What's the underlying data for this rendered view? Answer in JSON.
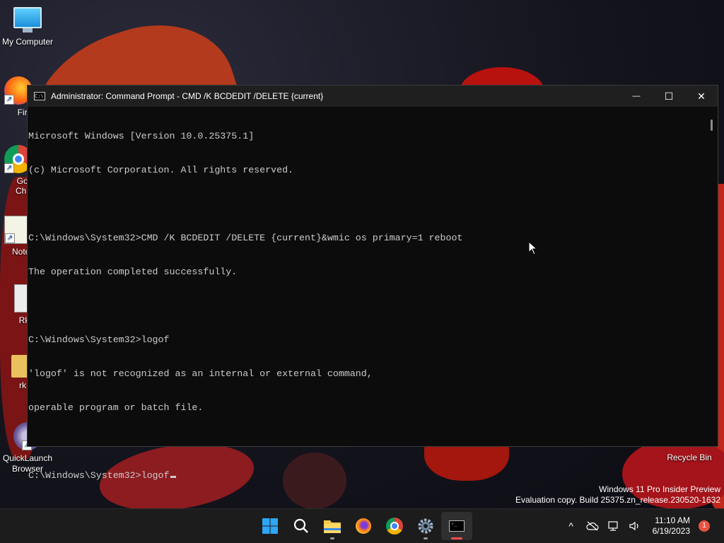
{
  "desktop": {
    "icons": [
      {
        "label": "My Computer"
      },
      {
        "label": "Fire"
      },
      {
        "label": "Goo Chro"
      },
      {
        "label": "Notep"
      },
      {
        "label": "Rk"
      },
      {
        "label": "rk"
      },
      {
        "label": "QuickLaunch Browser"
      },
      {
        "label": "Recycle Bin"
      }
    ]
  },
  "window": {
    "title": "Administrator:  Command Prompt - CMD  /K BCDEDIT /DELETE {current}",
    "icon_text": "C:\\",
    "minimize_glyph": "—",
    "maximize_glyph": "☐",
    "close_glyph": "✕"
  },
  "console": {
    "lines": [
      "Microsoft Windows [Version 10.0.25375.1]",
      "(c) Microsoft Corporation. All rights reserved.",
      "",
      "C:\\Windows\\System32>CMD /K BCDEDIT /DELETE {current}&wmic os primary=1 reboot",
      "The operation completed successfully.",
      "",
      "C:\\Windows\\System32>logof",
      "'logof' is not recognized as an internal or external command,",
      "operable program or batch file.",
      "",
      "C:\\Windows\\System32>logof"
    ]
  },
  "watermark": {
    "line1": "Windows 11 Pro Insider Preview",
    "line2": "Evaluation copy. Build 25375.zn_release.230520-1632"
  },
  "taskbar": {
    "apps": [
      {
        "name": "start",
        "icon": "windows-logo-icon"
      },
      {
        "name": "search",
        "icon": "search-icon"
      },
      {
        "name": "file-explorer",
        "icon": "folder-icon"
      },
      {
        "name": "firefox",
        "icon": "firefox-icon"
      },
      {
        "name": "chrome",
        "icon": "chrome-icon"
      },
      {
        "name": "settings",
        "icon": "gear-icon"
      },
      {
        "name": "command-prompt",
        "icon": "terminal-icon"
      }
    ],
    "tray": {
      "chevron": "^",
      "time": "11:10 AM",
      "date": "6/19/2023",
      "notification_count": "1"
    }
  }
}
